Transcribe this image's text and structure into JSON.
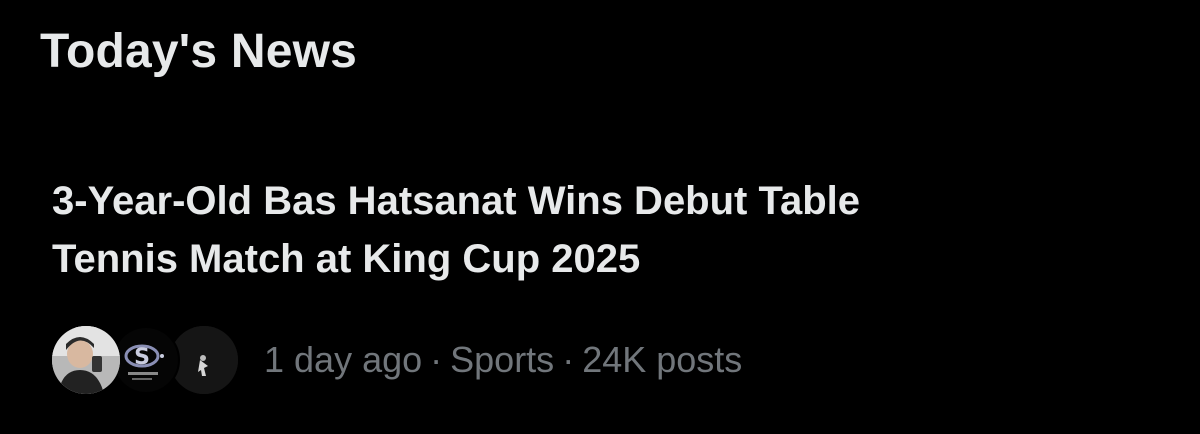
{
  "section": {
    "title": "Today's News"
  },
  "news": {
    "headline_line1": "3-Year-Old Bas Hatsanat Wins Debut Table",
    "headline_line2": "Tennis Match at King Cup 2025",
    "time": "1 day ago",
    "separator": "·",
    "category": "Sports",
    "posts": "24K posts"
  },
  "colors": {
    "background": "#000000",
    "primary_text": "#e7e9ea",
    "secondary_text": "#71767b"
  },
  "icons": [
    "avatar-person-photo",
    "avatar-logo-s",
    "avatar-dark-figure"
  ]
}
